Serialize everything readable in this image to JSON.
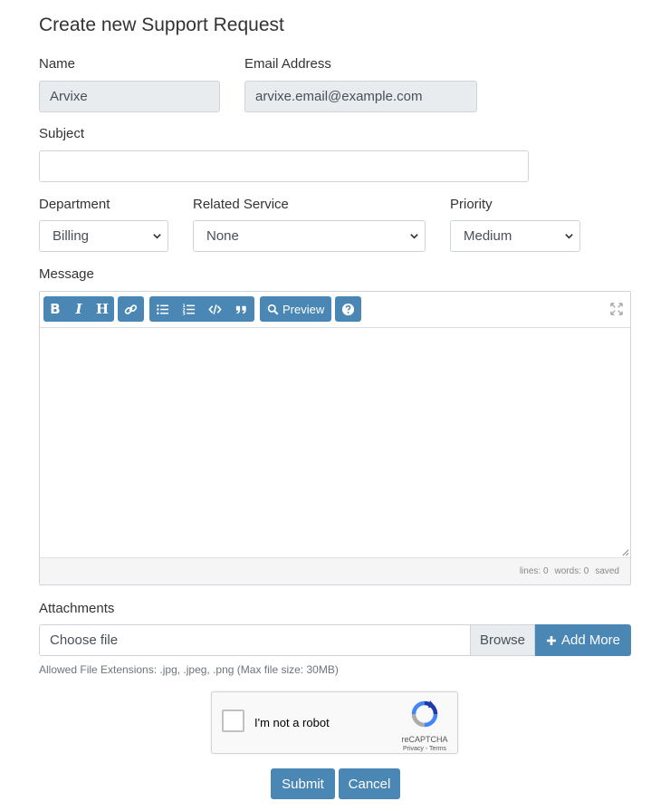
{
  "page": {
    "title": "Create new Support Request"
  },
  "fields": {
    "name": {
      "label": "Name",
      "value": "Arvixe"
    },
    "email": {
      "label": "Email Address",
      "value": "arvixe.email@example.com"
    },
    "subject": {
      "label": "Subject",
      "value": ""
    },
    "department": {
      "label": "Department",
      "value": "Billing"
    },
    "related_service": {
      "label": "Related Service",
      "value": "None"
    },
    "priority": {
      "label": "Priority",
      "value": "Medium"
    },
    "message": {
      "label": "Message",
      "value": ""
    }
  },
  "editor": {
    "toolbar": {
      "bold": "B",
      "italic": "I",
      "heading": "H",
      "preview": "Preview"
    },
    "status": {
      "lines": "lines: 0",
      "words": "words: 0",
      "saved": "saved"
    }
  },
  "attachments": {
    "label": "Attachments",
    "file_placeholder": "Choose file",
    "browse_label": "Browse",
    "add_more_label": "Add More",
    "hint": "Allowed File Extensions: .jpg, .jpeg, .png (Max file size: 30MB)"
  },
  "captcha": {
    "label": "I'm not a robot",
    "brand": "reCAPTCHA",
    "links": "Privacy - Terms"
  },
  "actions": {
    "submit": "Submit",
    "cancel": "Cancel"
  },
  "colors": {
    "accent": "#4a87b5",
    "readonly_bg": "#e9ecef",
    "border": "#ced4da"
  }
}
